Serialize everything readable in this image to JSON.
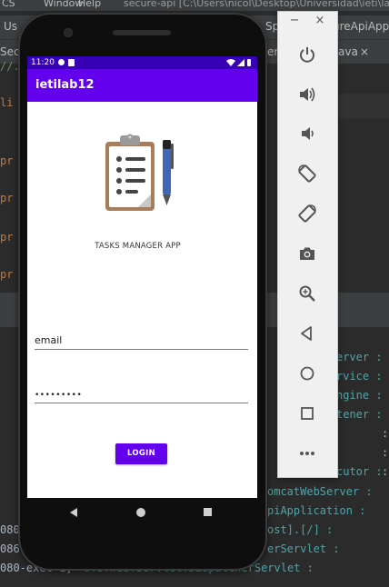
{
  "ide": {
    "menu": [
      "CS",
      "Window",
      "Help"
    ],
    "window_title": "secure-api [C:\\Users\\nicol\\Desktop\\Universidad\\ieti\\lab",
    "tabs": [
      "Us",
      "Sec",
      "Sp",
      "er",
      "ureApiApp"
    ],
    "subtab_label": "ava",
    "subtab_close": "×",
    "code_fragments": [
      "//.",
      "li",
      "pr",
      "pr",
      "pr",
      "pr"
    ],
    "console_lines": [
      {
        "prefix": "",
        "text": "erver :"
      },
      {
        "prefix": "",
        "text": "rvice :"
      },
      {
        "prefix": "",
        "text": "ngine :"
      },
      {
        "prefix": "",
        "text": "tener :"
      },
      {
        "prefix": "",
        "text": ":"
      },
      {
        "prefix": "",
        "text": ":"
      },
      {
        "prefix": "",
        "text": ":"
      },
      {
        "prefix": "",
        "text": "cutor :"
      },
      {
        "prefix": "",
        "text": "omcatWebServer :"
      },
      {
        "prefix": "",
        "text": "piApplication :"
      },
      {
        "prefix": "080",
        "text": "ost].[/] :"
      },
      {
        "prefix": "086",
        "text": "erServlet :"
      },
      {
        "prefix": "080-exec-1]",
        "text": "o.s.web.servlet.DispatcherServlet :"
      }
    ]
  },
  "phone": {
    "status": {
      "time": "11:20"
    },
    "app_title": "ietilab12",
    "logo_icon": "clipboard-checklist-pen-icon",
    "app_subtitle": "TASKS MANAGER APP",
    "email": {
      "value": "email"
    },
    "password": {
      "value": "•••••••••"
    },
    "login_label": "LOGIN"
  },
  "emulator": {
    "minimize": "−",
    "close": "×",
    "buttons": [
      "power-icon",
      "volume-up-icon",
      "volume-down-icon",
      "rotate-left-icon",
      "rotate-right-icon",
      "camera-icon",
      "zoom-icon",
      "back-icon",
      "home-icon",
      "overview-icon",
      "more-icon"
    ]
  },
  "colors": {
    "primary": "#6200ee",
    "primary_dark": "#3700b3",
    "ide_background": "#2b2b2b",
    "console_text": "#4ea5a8"
  }
}
